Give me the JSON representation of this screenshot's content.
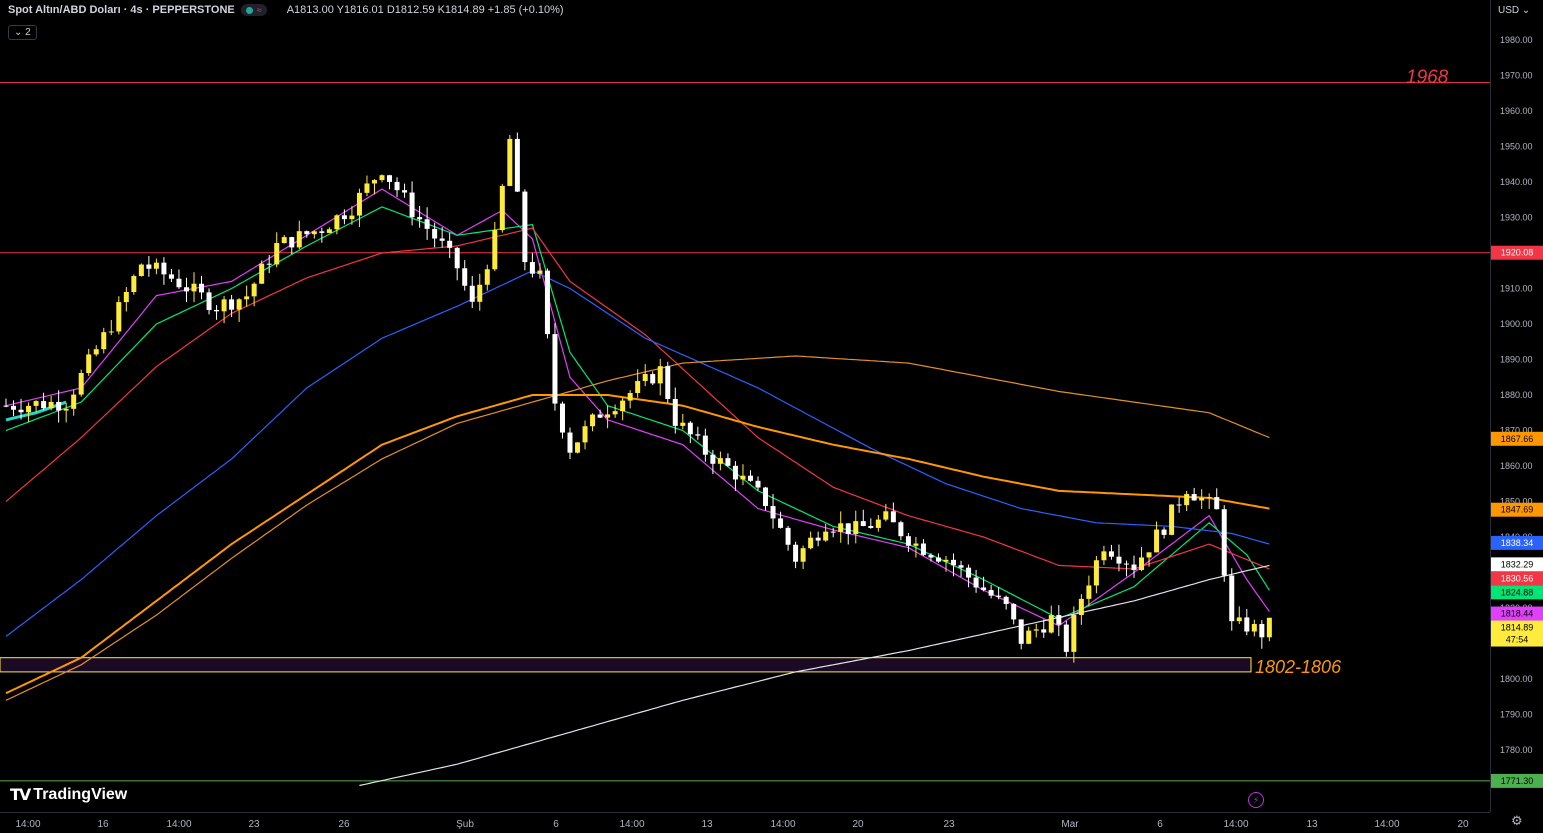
{
  "header": {
    "symbol": "Spot Altın/ABD Doları · 4s · PEPPERSTONE",
    "ohlc": "A1813.00 Y1816.01 D1812.59 K1814.89 +1.85 (+0.10%)",
    "indicator_count": "⌄ 2",
    "currency": "USD ⌄"
  },
  "branding": {
    "logo_text": "TradingView"
  },
  "annotations": {
    "level_1968": "1968",
    "zone_label": "1802-1806"
  },
  "price_badges": [
    {
      "label": "1920.08",
      "value": 1920.08,
      "color": "#f23645",
      "text_color": "#ffffff"
    },
    {
      "label": "1867.66",
      "value": 1867.66,
      "color": "#ff9800",
      "text_color": "#000000"
    },
    {
      "label": "1847.69",
      "value": 1847.69,
      "color": "#ff9800",
      "text_color": "#000000"
    },
    {
      "label": "1838.34",
      "value": 1838.34,
      "color": "#2962ff",
      "text_color": "#ffffff"
    },
    {
      "label": "1832.29",
      "value": 1832.29,
      "color": "#ffffff",
      "text_color": "#000000"
    },
    {
      "label": "1830.56",
      "value": 1830.56,
      "color": "#f23645",
      "text_color": "#ffffff"
    },
    {
      "label": "1824.88",
      "value": 1824.88,
      "color": "#00e676",
      "text_color": "#000000"
    },
    {
      "label": "1818.44",
      "value": 1818.44,
      "color": "#e040fb",
      "text_color": "#000000"
    },
    {
      "label": "1814.89",
      "value": 1814.89,
      "color": "#ffeb3b",
      "text_color": "#000000"
    },
    {
      "label": "1771.30",
      "value": 1771.3,
      "color": "#4caf50",
      "text_color": "#000000"
    }
  ],
  "countdown": "47:54",
  "chart_data": {
    "type": "candlestick",
    "title": "Spot Altın/ABD Doları · 4s · PEPPERSTONE",
    "ylim": [
      1766,
      1985
    ],
    "y_ticks": [
      1780,
      1790,
      1800,
      1810,
      1820,
      1830,
      1840,
      1850,
      1860,
      1870,
      1880,
      1890,
      1900,
      1910,
      1920,
      1930,
      1940,
      1950,
      1960,
      1970,
      1980
    ],
    "x_ticks": [
      "14:00",
      "16",
      "14:00",
      "23",
      "26",
      "Şub",
      "6",
      "14:00",
      "13",
      "14:00",
      "20",
      "23",
      "Mar",
      "6",
      "14:00",
      "13",
      "14:00",
      "20"
    ],
    "horizontal_lines": [
      {
        "value": 1968,
        "color": "#f23645"
      },
      {
        "value": 1920.08,
        "color": "#f23645"
      },
      {
        "value": 1771.3,
        "color": "#4caf50"
      }
    ],
    "zones": [
      {
        "from": 1802,
        "to": 1806,
        "label": "1802-1806",
        "color": "#ffeb3b"
      }
    ],
    "close_anchors": [
      [
        0,
        1877
      ],
      [
        8,
        1878
      ],
      [
        14,
        1900
      ],
      [
        18,
        1917
      ],
      [
        22,
        1913
      ],
      [
        28,
        1905
      ],
      [
        32,
        1908
      ],
      [
        36,
        1922
      ],
      [
        42,
        1927
      ],
      [
        46,
        1933
      ],
      [
        50,
        1944
      ],
      [
        54,
        1932
      ],
      [
        58,
        1922
      ],
      [
        60,
        1916
      ],
      [
        62,
        1905
      ],
      [
        65,
        1924
      ],
      [
        67,
        1952
      ],
      [
        69,
        1918
      ],
      [
        71,
        1913
      ],
      [
        73,
        1878
      ],
      [
        75,
        1865
      ],
      [
        79,
        1875
      ],
      [
        84,
        1882
      ],
      [
        87,
        1887
      ],
      [
        89,
        1873
      ],
      [
        93,
        1864
      ],
      [
        97,
        1858
      ],
      [
        101,
        1850
      ],
      [
        105,
        1834
      ],
      [
        109,
        1844
      ],
      [
        113,
        1842
      ],
      [
        117,
        1845
      ],
      [
        121,
        1838
      ],
      [
        125,
        1834
      ],
      [
        129,
        1827
      ],
      [
        133,
        1820
      ],
      [
        135,
        1811
      ],
      [
        139,
        1817
      ],
      [
        141,
        1809
      ],
      [
        143,
        1823
      ],
      [
        146,
        1838
      ],
      [
        150,
        1832
      ],
      [
        154,
        1843
      ],
      [
        157,
        1854
      ],
      [
        160,
        1849
      ],
      [
        161,
        1847
      ],
      [
        163,
        1815
      ],
      [
        165,
        1815
      ],
      [
        167,
        1813
      ],
      [
        168,
        1815
      ]
    ],
    "moving_averages": [
      {
        "name": "MA magenta",
        "color": "#e040fb",
        "points": [
          [
            0,
            1877
          ],
          [
            10,
            1882
          ],
          [
            20,
            1908
          ],
          [
            30,
            1912
          ],
          [
            40,
            1925
          ],
          [
            50,
            1938
          ],
          [
            60,
            1925
          ],
          [
            66,
            1932
          ],
          [
            70,
            1924
          ],
          [
            75,
            1885
          ],
          [
            80,
            1873
          ],
          [
            90,
            1866
          ],
          [
            100,
            1848
          ],
          [
            110,
            1842
          ],
          [
            120,
            1837
          ],
          [
            130,
            1825
          ],
          [
            140,
            1815
          ],
          [
            150,
            1830
          ],
          [
            160,
            1846
          ],
          [
            165,
            1828
          ],
          [
            168,
            1819
          ]
        ]
      },
      {
        "name": "MA green",
        "color": "#00e676",
        "points": [
          [
            0,
            1870
          ],
          [
            10,
            1878
          ],
          [
            20,
            1900
          ],
          [
            30,
            1910
          ],
          [
            40,
            1922
          ],
          [
            50,
            1933
          ],
          [
            60,
            1925
          ],
          [
            70,
            1928
          ],
          [
            75,
            1892
          ],
          [
            80,
            1877
          ],
          [
            90,
            1870
          ],
          [
            100,
            1853
          ],
          [
            110,
            1843
          ],
          [
            120,
            1838
          ],
          [
            130,
            1828
          ],
          [
            140,
            1817
          ],
          [
            150,
            1826
          ],
          [
            160,
            1844
          ],
          [
            165,
            1835
          ],
          [
            168,
            1825
          ]
        ]
      },
      {
        "name": "MA red",
        "color": "#f23645",
        "points": [
          [
            0,
            1850
          ],
          [
            10,
            1868
          ],
          [
            20,
            1888
          ],
          [
            30,
            1903
          ],
          [
            40,
            1913
          ],
          [
            50,
            1920
          ],
          [
            60,
            1922
          ],
          [
            70,
            1927
          ],
          [
            75,
            1912
          ],
          [
            85,
            1897
          ],
          [
            100,
            1868
          ],
          [
            110,
            1854
          ],
          [
            120,
            1846
          ],
          [
            130,
            1840
          ],
          [
            140,
            1832
          ],
          [
            150,
            1831
          ],
          [
            160,
            1838
          ],
          [
            168,
            1831
          ]
        ]
      },
      {
        "name": "MA blue",
        "color": "#2962ff",
        "points": [
          [
            0,
            1812
          ],
          [
            10,
            1828
          ],
          [
            20,
            1846
          ],
          [
            30,
            1862
          ],
          [
            40,
            1882
          ],
          [
            50,
            1896
          ],
          [
            60,
            1905
          ],
          [
            70,
            1915
          ],
          [
            75,
            1910
          ],
          [
            85,
            1896
          ],
          [
            100,
            1882
          ],
          [
            115,
            1865
          ],
          [
            125,
            1855
          ],
          [
            135,
            1848
          ],
          [
            145,
            1844
          ],
          [
            155,
            1843
          ],
          [
            163,
            1841
          ],
          [
            168,
            1838
          ]
        ]
      },
      {
        "name": "MA orange thick",
        "color": "#ff9800",
        "points": [
          [
            0,
            1796
          ],
          [
            10,
            1806
          ],
          [
            20,
            1822
          ],
          [
            30,
            1838
          ],
          [
            40,
            1852
          ],
          [
            50,
            1866
          ],
          [
            60,
            1874
          ],
          [
            70,
            1880
          ],
          [
            80,
            1880
          ],
          [
            90,
            1877
          ],
          [
            100,
            1871
          ],
          [
            110,
            1866
          ],
          [
            120,
            1862
          ],
          [
            130,
            1857
          ],
          [
            140,
            1853
          ],
          [
            150,
            1852
          ],
          [
            160,
            1851
          ],
          [
            168,
            1848
          ]
        ]
      },
      {
        "name": "MA orange thin",
        "color": "#e38f2a",
        "points": [
          [
            0,
            1794
          ],
          [
            10,
            1804
          ],
          [
            20,
            1818
          ],
          [
            30,
            1834
          ],
          [
            40,
            1849
          ],
          [
            50,
            1862
          ],
          [
            60,
            1872
          ],
          [
            70,
            1878
          ],
          [
            80,
            1884
          ],
          [
            90,
            1889
          ],
          [
            105,
            1891
          ],
          [
            120,
            1889
          ],
          [
            130,
            1885
          ],
          [
            140,
            1881
          ],
          [
            150,
            1878
          ],
          [
            160,
            1875
          ],
          [
            168,
            1868
          ]
        ]
      },
      {
        "name": "MA white",
        "color": "#e0e3eb",
        "points": [
          [
            47,
            1770
          ],
          [
            60,
            1776
          ],
          [
            75,
            1785
          ],
          [
            90,
            1794
          ],
          [
            105,
            1802
          ],
          [
            120,
            1808
          ],
          [
            135,
            1815
          ],
          [
            150,
            1822
          ],
          [
            160,
            1828
          ],
          [
            168,
            1832
          ]
        ]
      },
      {
        "name": "MA cyan",
        "color": "#26d7c4",
        "points": [
          [
            0,
            1873
          ],
          [
            4,
            1875
          ],
          [
            8,
            1878
          ]
        ]
      }
    ]
  }
}
